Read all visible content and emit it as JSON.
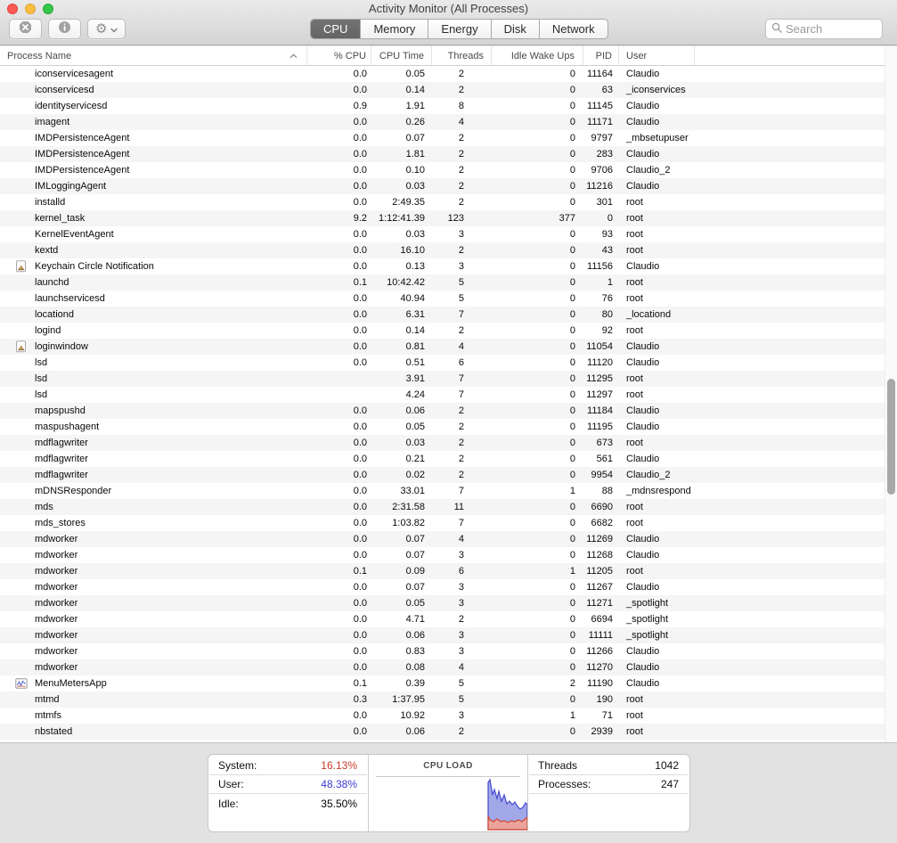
{
  "window": {
    "title": "Activity Monitor (All Processes)"
  },
  "toolbar": {
    "segments": [
      "CPU",
      "Memory",
      "Energy",
      "Disk",
      "Network"
    ],
    "active_segment": "CPU",
    "search_placeholder": "Search",
    "icons": [
      "quit-process-icon",
      "inspect-icon",
      "gear-icon",
      "chevron-down-icon",
      "search-icon"
    ]
  },
  "table": {
    "columns": [
      "Process Name",
      "% CPU",
      "CPU Time",
      "Threads",
      "Idle Wake Ups",
      "PID",
      "User"
    ],
    "sort_column": "Process Name",
    "sort_direction": "ascending",
    "rows": [
      {
        "name": "iconservicesagent",
        "icon": "",
        "cpu": "0.0",
        "time": "0.05",
        "threads": "2",
        "idle": "0",
        "pid": "11164",
        "user": "Claudio"
      },
      {
        "name": "iconservicesd",
        "icon": "",
        "cpu": "0.0",
        "time": "0.14",
        "threads": "2",
        "idle": "0",
        "pid": "63",
        "user": "_iconservices"
      },
      {
        "name": "identityservicesd",
        "icon": "",
        "cpu": "0.9",
        "time": "1.91",
        "threads": "8",
        "idle": "0",
        "pid": "11145",
        "user": "Claudio"
      },
      {
        "name": "imagent",
        "icon": "",
        "cpu": "0.0",
        "time": "0.26",
        "threads": "4",
        "idle": "0",
        "pid": "11171",
        "user": "Claudio"
      },
      {
        "name": "IMDPersistenceAgent",
        "icon": "",
        "cpu": "0.0",
        "time": "0.07",
        "threads": "2",
        "idle": "0",
        "pid": "9797",
        "user": "_mbsetupuser"
      },
      {
        "name": "IMDPersistenceAgent",
        "icon": "",
        "cpu": "0.0",
        "time": "1.81",
        "threads": "2",
        "idle": "0",
        "pid": "283",
        "user": "Claudio"
      },
      {
        "name": "IMDPersistenceAgent",
        "icon": "",
        "cpu": "0.0",
        "time": "0.10",
        "threads": "2",
        "idle": "0",
        "pid": "9706",
        "user": "Claudio_2"
      },
      {
        "name": "IMLoggingAgent",
        "icon": "",
        "cpu": "0.0",
        "time": "0.03",
        "threads": "2",
        "idle": "0",
        "pid": "11216",
        "user": "Claudio"
      },
      {
        "name": "installd",
        "icon": "",
        "cpu": "0.0",
        "time": "2:49.35",
        "threads": "2",
        "idle": "0",
        "pid": "301",
        "user": "root"
      },
      {
        "name": "kernel_task",
        "icon": "",
        "cpu": "9.2",
        "time": "1:12:41.39",
        "threads": "123",
        "idle": "377",
        "pid": "0",
        "user": "root"
      },
      {
        "name": "KernelEventAgent",
        "icon": "",
        "cpu": "0.0",
        "time": "0.03",
        "threads": "3",
        "idle": "0",
        "pid": "93",
        "user": "root"
      },
      {
        "name": "kextd",
        "icon": "",
        "cpu": "0.0",
        "time": "16.10",
        "threads": "2",
        "idle": "0",
        "pid": "43",
        "user": "root"
      },
      {
        "name": "Keychain Circle Notification",
        "icon": "keychain-app-icon",
        "cpu": "0.0",
        "time": "0.13",
        "threads": "3",
        "idle": "0",
        "pid": "11156",
        "user": "Claudio"
      },
      {
        "name": "launchd",
        "icon": "",
        "cpu": "0.1",
        "time": "10:42.42",
        "threads": "5",
        "idle": "0",
        "pid": "1",
        "user": "root"
      },
      {
        "name": "launchservicesd",
        "icon": "",
        "cpu": "0.0",
        "time": "40.94",
        "threads": "5",
        "idle": "0",
        "pid": "76",
        "user": "root"
      },
      {
        "name": "locationd",
        "icon": "",
        "cpu": "0.0",
        "time": "6.31",
        "threads": "7",
        "idle": "0",
        "pid": "80",
        "user": "_locationd"
      },
      {
        "name": "logind",
        "icon": "",
        "cpu": "0.0",
        "time": "0.14",
        "threads": "2",
        "idle": "0",
        "pid": "92",
        "user": "root"
      },
      {
        "name": "loginwindow",
        "icon": "loginwindow-app-icon",
        "cpu": "0.0",
        "time": "0.81",
        "threads": "4",
        "idle": "0",
        "pid": "11054",
        "user": "Claudio"
      },
      {
        "name": "lsd",
        "icon": "",
        "cpu": "0.0",
        "time": "0.51",
        "threads": "6",
        "idle": "0",
        "pid": "11120",
        "user": "Claudio"
      },
      {
        "name": "lsd",
        "icon": "",
        "cpu": "",
        "time": "3.91",
        "threads": "7",
        "idle": "0",
        "pid": "11295",
        "user": "root"
      },
      {
        "name": "lsd",
        "icon": "",
        "cpu": "",
        "time": "4.24",
        "threads": "7",
        "idle": "0",
        "pid": "11297",
        "user": "root"
      },
      {
        "name": "mapspushd",
        "icon": "",
        "cpu": "0.0",
        "time": "0.06",
        "threads": "2",
        "idle": "0",
        "pid": "11184",
        "user": "Claudio"
      },
      {
        "name": "maspushagent",
        "icon": "",
        "cpu": "0.0",
        "time": "0.05",
        "threads": "2",
        "idle": "0",
        "pid": "11195",
        "user": "Claudio"
      },
      {
        "name": "mdflagwriter",
        "icon": "",
        "cpu": "0.0",
        "time": "0.03",
        "threads": "2",
        "idle": "0",
        "pid": "673",
        "user": "root"
      },
      {
        "name": "mdflagwriter",
        "icon": "",
        "cpu": "0.0",
        "time": "0.21",
        "threads": "2",
        "idle": "0",
        "pid": "561",
        "user": "Claudio"
      },
      {
        "name": "mdflagwriter",
        "icon": "",
        "cpu": "0.0",
        "time": "0.02",
        "threads": "2",
        "idle": "0",
        "pid": "9954",
        "user": "Claudio_2"
      },
      {
        "name": "mDNSResponder",
        "icon": "",
        "cpu": "0.0",
        "time": "33.01",
        "threads": "7",
        "idle": "1",
        "pid": "88",
        "user": "_mdnsrespond"
      },
      {
        "name": "mds",
        "icon": "",
        "cpu": "0.0",
        "time": "2:31.58",
        "threads": "11",
        "idle": "0",
        "pid": "6690",
        "user": "root"
      },
      {
        "name": "mds_stores",
        "icon": "",
        "cpu": "0.0",
        "time": "1:03.82",
        "threads": "7",
        "idle": "0",
        "pid": "6682",
        "user": "root"
      },
      {
        "name": "mdworker",
        "icon": "",
        "cpu": "0.0",
        "time": "0.07",
        "threads": "4",
        "idle": "0",
        "pid": "11269",
        "user": "Claudio"
      },
      {
        "name": "mdworker",
        "icon": "",
        "cpu": "0.0",
        "time": "0.07",
        "threads": "3",
        "idle": "0",
        "pid": "11268",
        "user": "Claudio"
      },
      {
        "name": "mdworker",
        "icon": "",
        "cpu": "0.1",
        "time": "0.09",
        "threads": "6",
        "idle": "1",
        "pid": "11205",
        "user": "root"
      },
      {
        "name": "mdworker",
        "icon": "",
        "cpu": "0.0",
        "time": "0.07",
        "threads": "3",
        "idle": "0",
        "pid": "11267",
        "user": "Claudio"
      },
      {
        "name": "mdworker",
        "icon": "",
        "cpu": "0.0",
        "time": "0.05",
        "threads": "3",
        "idle": "0",
        "pid": "11271",
        "user": "_spotlight"
      },
      {
        "name": "mdworker",
        "icon": "",
        "cpu": "0.0",
        "time": "4.71",
        "threads": "2",
        "idle": "0",
        "pid": "6694",
        "user": "_spotlight"
      },
      {
        "name": "mdworker",
        "icon": "",
        "cpu": "0.0",
        "time": "0.06",
        "threads": "3",
        "idle": "0",
        "pid": "11111",
        "user": "_spotlight"
      },
      {
        "name": "mdworker",
        "icon": "",
        "cpu": "0.0",
        "time": "0.83",
        "threads": "3",
        "idle": "0",
        "pid": "11266",
        "user": "Claudio"
      },
      {
        "name": "mdworker",
        "icon": "",
        "cpu": "0.0",
        "time": "0.08",
        "threads": "4",
        "idle": "0",
        "pid": "11270",
        "user": "Claudio"
      },
      {
        "name": "MenuMetersApp",
        "icon": "menumeters-app-icon",
        "cpu": "0.1",
        "time": "0.39",
        "threads": "5",
        "idle": "2",
        "pid": "11190",
        "user": "Claudio"
      },
      {
        "name": "mtmd",
        "icon": "",
        "cpu": "0.3",
        "time": "1:37.95",
        "threads": "5",
        "idle": "0",
        "pid": "190",
        "user": "root"
      },
      {
        "name": "mtmfs",
        "icon": "",
        "cpu": "0.0",
        "time": "10.92",
        "threads": "3",
        "idle": "1",
        "pid": "71",
        "user": "root"
      },
      {
        "name": "nbstated",
        "icon": "",
        "cpu": "0.0",
        "time": "0.06",
        "threads": "2",
        "idle": "0",
        "pid": "2939",
        "user": "root"
      }
    ]
  },
  "footer": {
    "cpu_stats": [
      {
        "label": "System:",
        "value": "16.13%",
        "color": "#cb3a28"
      },
      {
        "label": "User:",
        "value": "48.38%",
        "color": "#3c3ad4"
      },
      {
        "label": "Idle:",
        "value": "35.50%",
        "color": "#000000"
      }
    ],
    "right_stats": [
      {
        "label": "Threads",
        "value": "1042"
      },
      {
        "label": "Processes:",
        "value": "247"
      }
    ],
    "cpu_load_graph": {
      "title": "CPU LOAD",
      "type": "area",
      "user_fill": "#9298e4",
      "user_stroke": "#4348cf",
      "user_opacity": "0.85",
      "system_fill": "#f2a494",
      "system_stroke": "#d2452e",
      "system_opacity": "0.9",
      "user_points": [
        [
          134,
          86
        ],
        [
          134,
          33
        ],
        [
          136,
          30
        ],
        [
          139,
          47
        ],
        [
          141,
          41
        ],
        [
          144,
          51
        ],
        [
          146,
          43
        ],
        [
          149,
          54
        ],
        [
          152,
          47
        ],
        [
          155,
          57
        ],
        [
          158,
          54
        ],
        [
          161,
          58
        ],
        [
          164,
          55
        ],
        [
          167,
          60
        ],
        [
          170,
          63
        ],
        [
          173,
          61
        ],
        [
          176,
          56
        ],
        [
          178,
          58
        ],
        [
          178,
          86
        ]
      ],
      "system_points": [
        [
          134,
          86
        ],
        [
          134,
          71
        ],
        [
          136,
          75
        ],
        [
          140,
          77
        ],
        [
          144,
          74
        ],
        [
          148,
          77
        ],
        [
          152,
          76
        ],
        [
          156,
          78
        ],
        [
          160,
          76
        ],
        [
          164,
          77
        ],
        [
          168,
          75
        ],
        [
          172,
          77
        ],
        [
          178,
          72
        ],
        [
          178,
          86
        ]
      ]
    }
  }
}
